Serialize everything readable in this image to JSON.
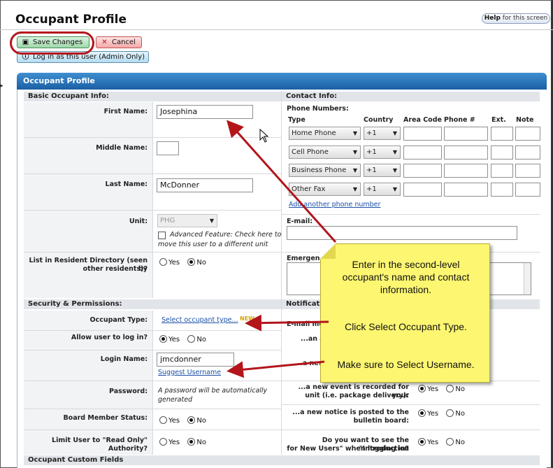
{
  "page": {
    "title": "Occupant Profile",
    "help_bold": "Help",
    "help_rest": " for this screen"
  },
  "toolbar": {
    "save_label": "Save Changes",
    "cancel_label": "Cancel",
    "admin_login_label": "Log in as this user (Admin Only)"
  },
  "panel": {
    "title": "Occupant Profile"
  },
  "basic": {
    "section_label": "Basic Occupant Info:",
    "first_name_label": "First Name:",
    "first_name_value": "Josephina",
    "middle_name_label": "Middle Name:",
    "middle_name_value": "",
    "last_name_label": "Last Name:",
    "last_name_value": "McDonner",
    "unit_label": "Unit:",
    "unit_value": "PHG",
    "advanced_text_1": "Advanced Feature: Check here to",
    "advanced_text_2": "move this user to a different unit",
    "directory_label_1": "List in Resident Directory (seen by",
    "directory_label_2": "other residents)?",
    "yes": "Yes",
    "no": "No"
  },
  "contact": {
    "section_label": "Contact Info:",
    "phone_numbers_label": "Phone Numbers:",
    "columns": [
      "Type",
      "Country",
      "Area Code",
      "Phone #",
      "Ext.",
      "Note"
    ],
    "phones": [
      {
        "type": "Home Phone",
        "country": "+1"
      },
      {
        "type": "Cell Phone",
        "country": "+1"
      },
      {
        "type": "Business Phone",
        "country": "+1"
      },
      {
        "type": "Other Fax",
        "country": "+1"
      }
    ],
    "add_phone_link": "Add another phone number",
    "email_label": "E-mail:",
    "emergency_label": "Emergency"
  },
  "security": {
    "section_label": "Security & Permissions:",
    "occupant_type_label": "Occupant Type:",
    "occupant_type_link": "Select occupant type...",
    "new_badge": "NEW",
    "allow_login_label": "Allow user to log in?",
    "login_name_label": "Login Name:",
    "login_name_value": "jmcdonner",
    "suggest_username_link": "Suggest Username",
    "password_label": "Password:",
    "password_text_1": "A password will be automatically",
    "password_text_2": "generated",
    "board_status_label": "Board Member Status:",
    "read_only_label": "Limit User to \"Read Only\" Authority?"
  },
  "notifications": {
    "section_label": "Notificatio",
    "email_me_label": "E-mail me",
    "row1": "...an a",
    "row2": "...a new",
    "event_label_1": "...a new event is recorded for your",
    "event_label_2": "unit (i.e. package delivery):",
    "notice_label_1": "...a new notice is posted to the",
    "notice_label_2": "bulletin board:",
    "intro_label_1": "Do you want to see the \"Introduction",
    "intro_label_2": "for New Users\" when logging in?"
  },
  "custom_fields": {
    "section_label": "Occupant Custom Fields"
  },
  "callouts": {
    "line1": "Enter in the second-level",
    "line2": "occupant's name and contact",
    "line3": "information.",
    "occupant_type": "Click Select Occupant Type.",
    "username": "Make sure to Select Username."
  },
  "colors": {
    "annotation_red": "#b3151b",
    "sticky_yellow": "#fdf671",
    "header_blue": "#1a5fa5"
  }
}
